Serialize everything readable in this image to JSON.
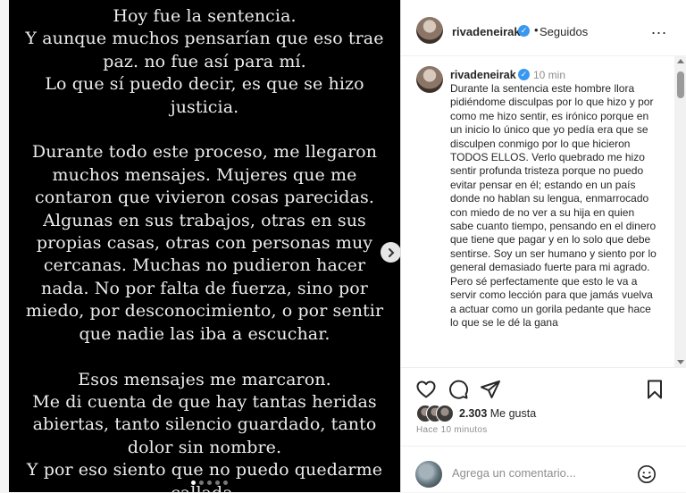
{
  "post_image": {
    "text": "Hoy fue la sentencia.\nY aunque muchos pensarían que eso trae\npaz. no fue así para mí.\nLo que sí puedo decir, es que se hizo\njusticia.\n\nDurante todo este proceso, me llegaron\nmuchos mensajes. Mujeres que me\ncontaron que vivieron cosas parecidas.\nAlgunas en sus trabajos, otras en sus\npropias casas, otras con personas muy\ncercanas. Muchas no pudieron hacer\nnada. No por falta de fuerza, sino por\nmiedo, por desconocimiento, o por sentir\nque nadie las iba a escuchar.\n\nEsos mensajes me marcaron.\nMe di cuenta de que hay tantas heridas\nabiertas, tanto silencio guardado, tanto\ndolor sin nombre.\nY por eso siento que no puedo quedarme\ncallada."
  },
  "header": {
    "username": "rivadeneirak",
    "separator": "•",
    "follow_status": "Seguidos",
    "more": "..."
  },
  "caption": {
    "username": "rivadeneirak",
    "time": "10 min",
    "text": "Durante la sentencia este hombre llora pidiéndome disculpas por lo que hizo y por como me hizo sentir, es irónico porque en un inicio lo único que yo pedía era que se disculpen conmigo por lo que hicieron TODOS ELLOS. Verlo quebrado me hizo sentir profunda tristeza porque no puedo evitar pensar en él; estando en un país donde no hablan su lengua, enmarrocado con miedo de no ver a su hija en quien sabe cuanto tiempo, pensando en el dinero que tiene que pagar y en lo solo que debe sentirse. Soy un ser humano y siento por lo general demasiado fuerte para mi agrado.  Pero sé perfectamente que esto le va a servir como lección para que jamás vuelva a actuar como un gorila pedante que hace lo que se le dé la gana"
  },
  "likes": {
    "count": "2.303",
    "label": "Me gusta"
  },
  "post_time": "Hace 10 minutos",
  "comment_input": {
    "placeholder": "Agrega un comentario..."
  },
  "colors": {
    "verified": "#3897f0",
    "text": "#262626",
    "muted": "#8e8e8e"
  },
  "icons": [
    "chevron-right-icon",
    "verified-icon",
    "more-icon",
    "heart-icon",
    "comment-icon",
    "share-icon",
    "bookmark-icon",
    "emoji-icon"
  ]
}
